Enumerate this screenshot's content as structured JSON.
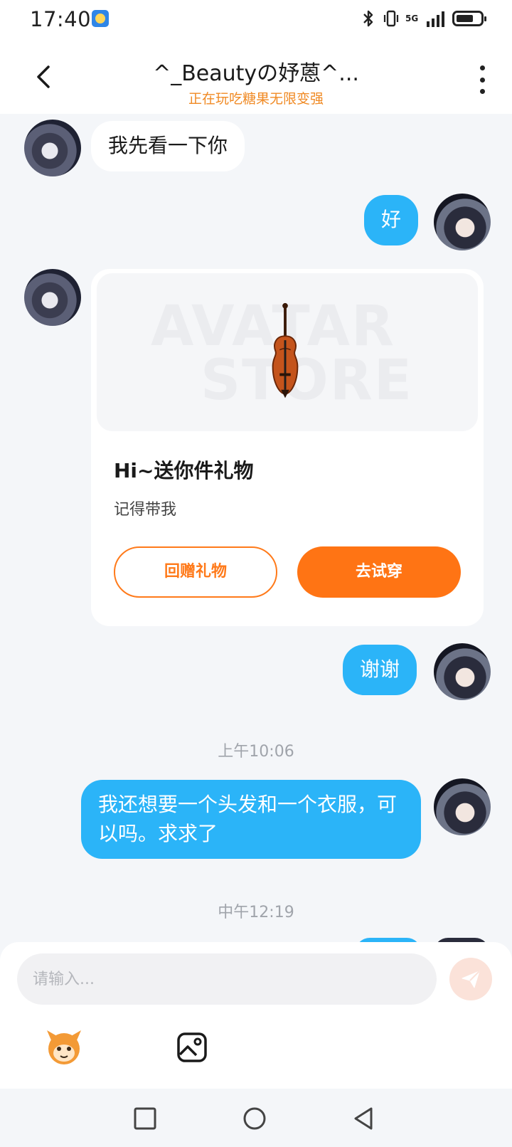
{
  "status_bar": {
    "time": "17:40",
    "network": "5G"
  },
  "header": {
    "title": "^_Beautyの妤蒽^...",
    "subtitle": "正在玩吃糖果无限变强"
  },
  "messages": {
    "m1": "我先看一下你",
    "m2": "好",
    "m3": "谢谢",
    "m4": "我还想要一个头发和一个衣服，可以吗。求求了"
  },
  "gift_card": {
    "watermark_top": "AVATAR",
    "watermark_bottom": "STORE",
    "title": "Hi~送你件礼物",
    "description": "记得带我",
    "return_gift_label": "回赠礼物",
    "try_on_label": "去试穿"
  },
  "timestamps": {
    "t1": "上午10:06",
    "t2": "中午12:19"
  },
  "composer": {
    "placeholder": "请输入..."
  },
  "colors": {
    "accent_orange": "#ff7414",
    "bubble_blue": "#2bb4f8",
    "subtitle_orange": "#f08a24"
  }
}
